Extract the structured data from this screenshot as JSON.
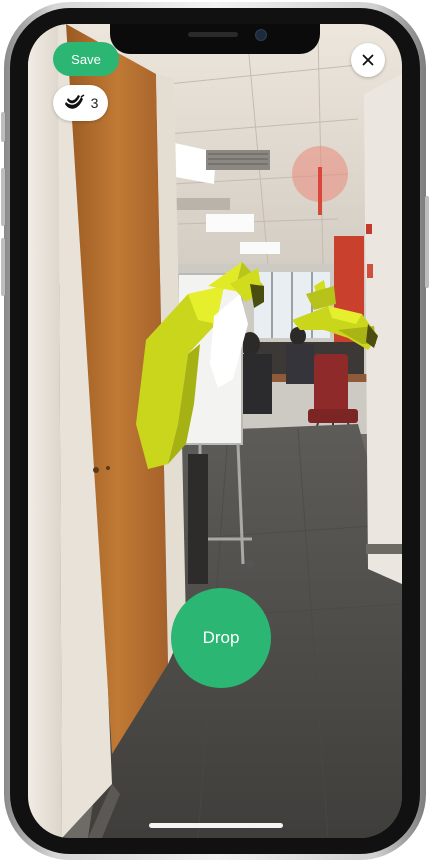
{
  "ar_screen": {
    "save_label": "Save",
    "banana_count": "3",
    "drop_label": "Drop",
    "icons": {
      "close": "close-icon",
      "banana": "banana-icon"
    }
  },
  "colors": {
    "accent_green": "#2bb673",
    "banana_yellow": "#d6e21a",
    "pill_white": "#ffffff"
  }
}
